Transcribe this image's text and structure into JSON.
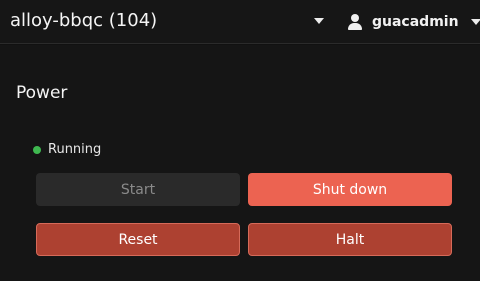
{
  "header": {
    "title": "alloy-bbqc (104)",
    "menu_icon": "chevron-down-icon",
    "user": {
      "icon": "user-icon",
      "name": "guacadmin",
      "menu_icon": "chevron-down-icon"
    }
  },
  "power": {
    "title": "Power",
    "status": {
      "label": "Running",
      "color": "#3fb850"
    },
    "buttons": {
      "start": "Start",
      "shutdown": "Shut down",
      "reset": "Reset",
      "halt": "Halt"
    }
  },
  "colors": {
    "background": "#151515",
    "danger": "#ec6351",
    "danger_dark": "#ad4131",
    "disabled": "#2a2a2a"
  }
}
